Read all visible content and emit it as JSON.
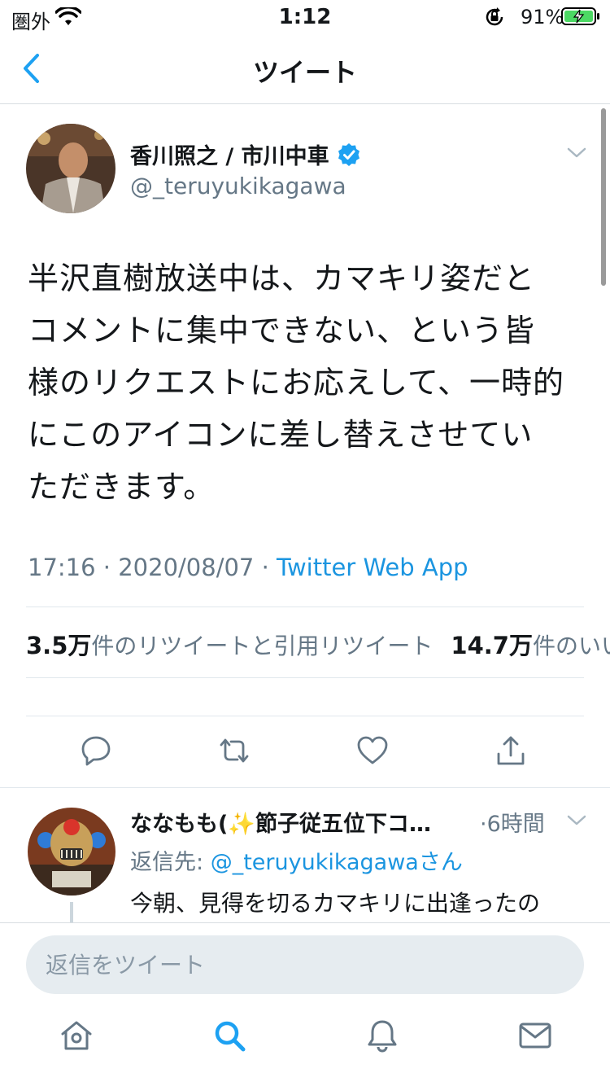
{
  "status_bar": {
    "carrier": "圏外",
    "time": "1:12",
    "battery": "91%"
  },
  "nav": {
    "title": "ツイート"
  },
  "tweet": {
    "author_name": "香川照之 / 市川中車",
    "author_handle": "@_teruyukikagawa",
    "text": "半沢直樹放送中は、カマキリ姿だとコメントに集中できない、という皆様のリクエストにお応えして、一時的にこのアイコンに差し替えさせていただきます。",
    "timestamp": "17:16 · 2020/08/07 · ",
    "source": "Twitter Web App",
    "retweet_count": "3.5万",
    "retweet_label": "件のリツイートと引用リツイート",
    "like_count": "14.7万",
    "like_label": "件のいいね"
  },
  "reply": {
    "author_name": "ななもも(✨節子従五位下コ…",
    "time": "·6時間",
    "reply_to_label": "返信先: ",
    "reply_to_handle": "@_teruyukikagawaさん",
    "text": "今朝、見得を切るカマキリに出逢ったの"
  },
  "composer": {
    "placeholder": "返信をツイート"
  },
  "colors": {
    "accent": "#1da1f2",
    "link": "#1b95e0",
    "secondary_text": "#657786",
    "battery_green": "#4cd964"
  },
  "icons": {
    "nav_back": "chevron-left-icon",
    "verified": "verified-badge-icon",
    "reply": "reply-icon",
    "retweet": "retweet-icon",
    "like": "heart-icon",
    "share": "share-icon",
    "tab_home": "home-icon",
    "tab_search": "search-icon",
    "tab_notifications": "bell-icon",
    "tab_messages": "mail-icon"
  }
}
